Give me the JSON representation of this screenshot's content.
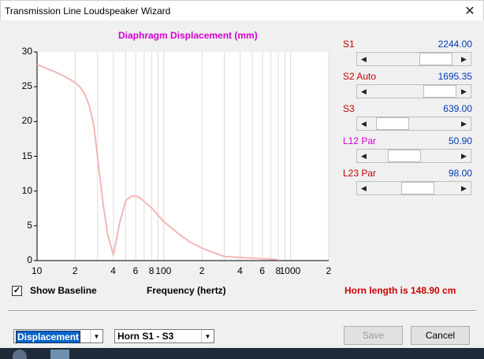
{
  "window": {
    "title": "Transmission Line Loudspeaker Wizard",
    "close_glyph": "✕"
  },
  "chart_data": {
    "type": "line",
    "title": "Diaphragm Displacement (mm)",
    "xlabel": "Frequency (hertz)",
    "xscale": "log",
    "xlim": [
      10,
      2000
    ],
    "ylim": [
      0,
      30
    ],
    "yticks": [
      "0",
      "5",
      "10",
      "15",
      "20",
      "25",
      "30"
    ],
    "xticks": [
      "10",
      "2",
      "4",
      "6",
      "8",
      "100",
      "2",
      "4",
      "6",
      "8",
      "1000",
      "2"
    ],
    "grid": true,
    "line_color": "#f5b6b6",
    "series": [
      {
        "x": [
          10,
          12,
          14,
          16,
          18,
          20,
          22,
          24,
          26,
          28,
          30,
          33,
          36,
          40,
          45,
          50,
          55,
          60,
          65,
          70,
          80,
          100,
          130,
          160,
          200,
          250,
          300,
          400,
          500,
          700,
          800
        ],
        "y": [
          28.2,
          27.6,
          27.1,
          26.6,
          26.1,
          25.6,
          24.9,
          23.8,
          22.1,
          19.5,
          15.0,
          8.5,
          3.8,
          0.8,
          5.5,
          8.6,
          9.2,
          9.3,
          9.0,
          8.5,
          7.6,
          5.6,
          3.9,
          2.7,
          1.8,
          1.1,
          0.6,
          0.45,
          0.35,
          0.2,
          0.15
        ]
      }
    ]
  },
  "sliders": [
    {
      "label": "S1",
      "value": "2244.00",
      "label_color": "#c00000",
      "position": 0.91
    },
    {
      "label": "S2  Auto",
      "value": "1695.35",
      "label_color": "#c00000",
      "position": 0.98
    },
    {
      "label": "S3",
      "value": "639.00",
      "label_color": "#c00000",
      "position": 0.1
    },
    {
      "label": "L12  Par",
      "value": "50.90",
      "label_color": "#d400d4",
      "position": 0.32
    },
    {
      "label": "L23  Par",
      "value": "98.00",
      "label_color": "#c00000",
      "position": 0.58
    }
  ],
  "options": {
    "show_baseline_label": "Show Baseline",
    "show_baseline_checked": true,
    "check_glyph": "✓"
  },
  "status": {
    "horn_length": "Horn length is 148.90 cm"
  },
  "controls": {
    "view_select": "Displacement",
    "horn_select": "Horn S1 - S3",
    "save_label": "Save",
    "cancel_label": "Cancel",
    "arrow_left": "◀",
    "arrow_right": "▶",
    "arrow_down": "▼"
  }
}
